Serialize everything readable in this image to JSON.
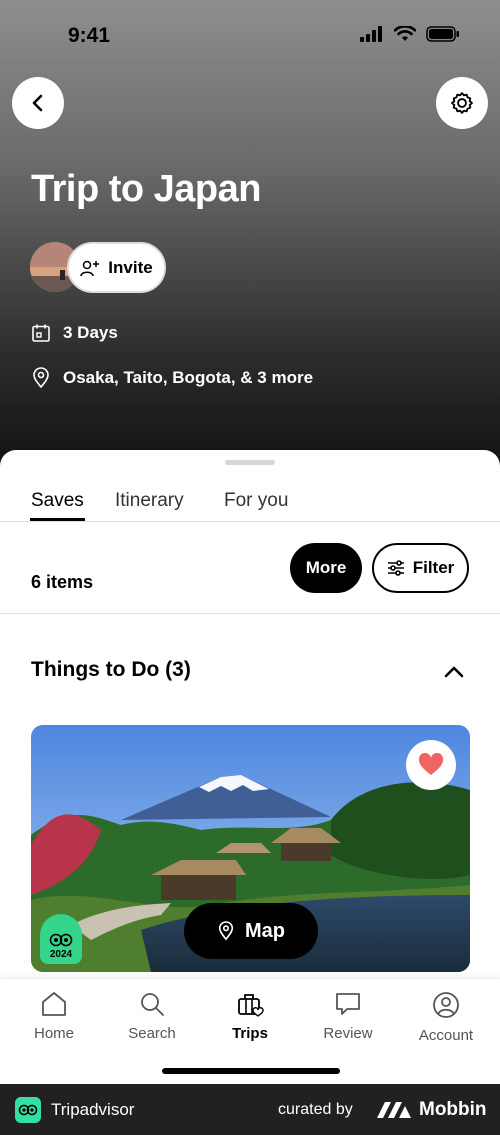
{
  "status_bar": {
    "time": "9:41"
  },
  "header": {
    "title": "Trip to Japan",
    "invite_label": "Invite",
    "days": "3 Days",
    "locations": "Osaka, Taito, Bogota, & 3 more"
  },
  "tabs": [
    {
      "label": "Saves",
      "active": true
    },
    {
      "label": "Itinerary",
      "active": false
    },
    {
      "label": "For you",
      "active": false
    }
  ],
  "toolbar": {
    "items_count": "6 items",
    "more_label": "More",
    "filter_label": "Filter"
  },
  "section": {
    "title": "Things to Do (3)",
    "card": {
      "award_year": "2024",
      "map_label": "Map",
      "favorited": true
    }
  },
  "bottom_nav": [
    {
      "label": "Home",
      "icon": "home-icon",
      "active": false
    },
    {
      "label": "Search",
      "icon": "search-icon",
      "active": false
    },
    {
      "label": "Trips",
      "icon": "trips-icon",
      "active": true
    },
    {
      "label": "Review",
      "icon": "review-icon",
      "active": false
    },
    {
      "label": "Account",
      "icon": "account-icon",
      "active": false
    }
  ],
  "footer": {
    "brand": "Tripadvisor",
    "curated_by": "curated by",
    "curator": "Mobbin"
  },
  "colors": {
    "accent_green": "#34e0a1",
    "heart_red": "#f06461",
    "primary_black": "#000000"
  }
}
